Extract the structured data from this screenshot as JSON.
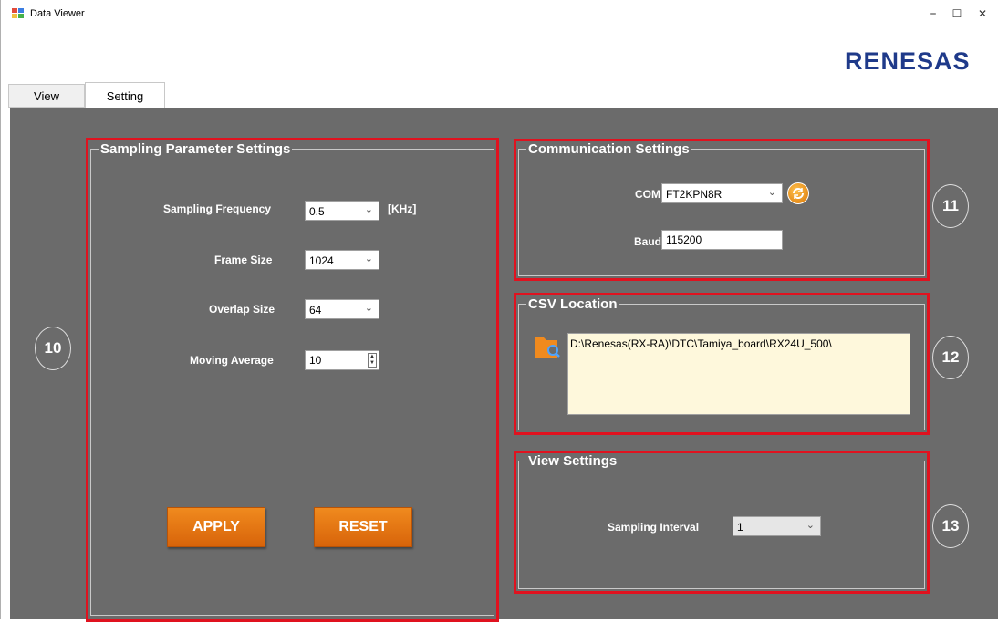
{
  "window": {
    "title": "Data Viewer",
    "minimize": "–",
    "maximize": "☐",
    "close": "✕"
  },
  "brand": {
    "logo": "RENESAS",
    "color": "#1f3a8a"
  },
  "tabs": [
    {
      "label": "View",
      "active": false
    },
    {
      "label": "Setting",
      "active": true
    }
  ],
  "sampling": {
    "title": "Sampling Parameter Settings",
    "frequency_label": "Sampling Frequency",
    "frequency_value": "0.5",
    "frequency_unit": "[KHz]",
    "frame_label": "Frame Size",
    "frame_value": "1024",
    "overlap_label": "Overlap Size",
    "overlap_value": "64",
    "moving_label": "Moving Average",
    "moving_value": "10",
    "apply_label": "APPLY",
    "reset_label": "RESET"
  },
  "communication": {
    "title": "Communication Settings",
    "com_label": "COM",
    "com_value": "FT2KPN8R",
    "baud_label": "Baud",
    "baud_value": "115200"
  },
  "csv": {
    "title": "CSV Location",
    "path": "D:\\Renesas(RX-RA)\\DTC\\Tamiya_board\\RX24U_500\\"
  },
  "view_settings": {
    "title": "View Settings",
    "interval_label": "Sampling Interval",
    "interval_value": "1"
  },
  "callouts": [
    "10",
    "11",
    "12",
    "13"
  ],
  "colors": {
    "highlight": "#e0121f",
    "panel_bg": "#6b6b6b",
    "button_orange": "#e87814",
    "csv_bg": "#fef8dc"
  }
}
